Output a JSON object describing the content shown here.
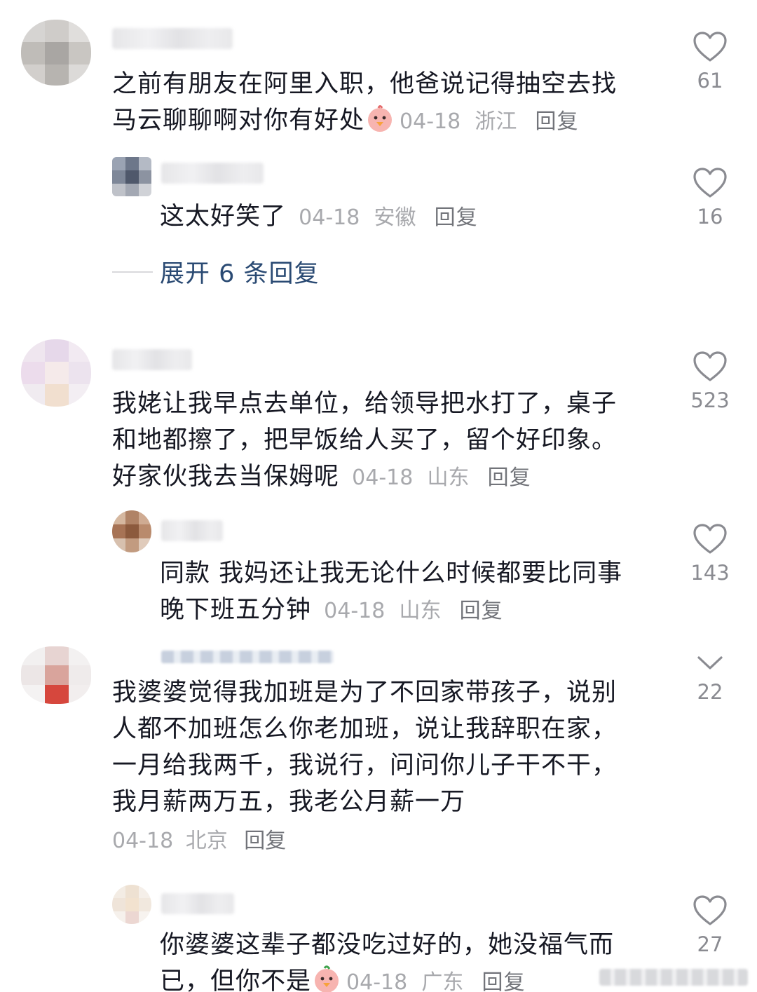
{
  "comments": [
    {
      "text_line1": "之前有朋友在阿里入职，他爸说记得抽空去找",
      "text_line2": "马云聊聊啊对你有好处",
      "date": "04-18",
      "location": "浙江",
      "reply": "回复",
      "likes": "61",
      "emoji": "chick-emoji"
    },
    {
      "text": "这太好笑了",
      "date": "04-18",
      "location": "安徽",
      "reply": "回复",
      "likes": "16"
    },
    {
      "text_line1": "我姥让我早点去单位，给领导把水打了，桌子",
      "text_line2": "和地都擦了，把早饭给人买了，留个好印象。",
      "text_line3": "好家伙我去当保姆呢",
      "date": "04-18",
      "location": "山东",
      "reply": "回复",
      "likes": "523"
    },
    {
      "text_line1": "同款 我妈还让我无论什么时候都要比同事",
      "text_line2": "晚下班五分钟",
      "date": "04-18",
      "location": "山东",
      "reply": "回复",
      "likes": "143"
    },
    {
      "text_line1": "我婆婆觉得我加班是为了不回家带孩子，说别",
      "text_line2": "人都不加班怎么你老加班，说让我辞职在家，",
      "text_line3": "一月给我两千，我说行，问问你儿子干不干，",
      "text_line4": "我月薪两万五，我老公月薪一万",
      "date": "04-18",
      "location": "北京",
      "reply": "回复",
      "likes": "22",
      "like_icon": "chevron-down-icon"
    },
    {
      "text_line1": "你婆婆这辈子都没吃过好的，她没福气而",
      "text_line2": "已，但你不是",
      "date": "04-18",
      "location": "广东",
      "reply": "回复",
      "likes": "27",
      "emoji": "chick-emoji"
    }
  ],
  "expand_replies": "展开 6 条回复",
  "colors": {
    "text": "#161823",
    "meta": "#a8a9ad",
    "link": "#2a4a73",
    "icon": "#8a8b91"
  }
}
